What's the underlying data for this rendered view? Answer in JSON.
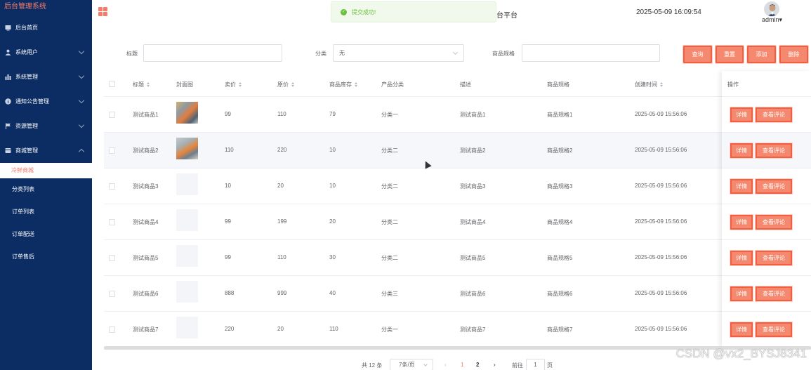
{
  "sidebar": {
    "brand": "后台管理系统",
    "items": [
      {
        "label": "后台首页",
        "icon": "home-icon"
      },
      {
        "label": "系统用户",
        "icon": "user-icon",
        "expandable": true
      },
      {
        "label": "系统管理",
        "icon": "bar-chart-icon",
        "expandable": true
      },
      {
        "label": "通知公告管理",
        "icon": "info-icon",
        "expandable": true
      },
      {
        "label": "资源管理",
        "icon": "flag-icon",
        "expandable": true
      },
      {
        "label": "商城管理",
        "icon": "shop-icon",
        "expandable": true,
        "expanded": true
      }
    ],
    "submenu": {
      "active": "冷鲜商城",
      "items": [
        "分类列表",
        "订单列表",
        "订单配送",
        "订单售后"
      ]
    }
  },
  "header": {
    "site_title_visible": "台平台",
    "datetime": "2025-05-09 16:09:54",
    "user": "admin▾",
    "toast": "提交成功!"
  },
  "search": {
    "title_label": "标题",
    "title_value": "",
    "category_label": "分类",
    "category_value": "无",
    "spec_label": "商品规格",
    "spec_value": "",
    "buttons": {
      "query": "查询",
      "reset": "重置",
      "add": "添加",
      "delete": "删除"
    }
  },
  "table": {
    "headers": {
      "title": "标题",
      "cover": "封面图",
      "price": "卖价",
      "original_price": "原价",
      "stock": "商品库存",
      "category": "产品分类",
      "description": "描述",
      "spec": "商品规格",
      "created": "创建时间",
      "ops": "操作"
    },
    "rows": [
      {
        "title": "测试商品1",
        "cover": "image",
        "price": "99",
        "original_price": "110",
        "stock": "79",
        "category": "分类一",
        "description": "测试商品1",
        "spec": "商品规格1",
        "created": "2025-05-09 15:56:06",
        "detail": "详情",
        "comments": "查看评论"
      },
      {
        "title": "测试商品2",
        "cover": "image",
        "price": "110",
        "original_price": "220",
        "stock": "10",
        "category": "分类二",
        "description": "测试商品2",
        "spec": "商品规格2",
        "created": "2025-05-09 15:56:06",
        "detail": "详情",
        "comments": "查看评论"
      },
      {
        "title": "测试商品3",
        "cover": "",
        "price": "10",
        "original_price": "20",
        "stock": "10",
        "category": "分类二",
        "description": "测试商品3",
        "spec": "商品规格3",
        "created": "2025-05-09 15:56:06",
        "detail": "详情",
        "comments": "查看评论"
      },
      {
        "title": "测试商品4",
        "cover": "",
        "price": "99",
        "original_price": "199",
        "stock": "20",
        "category": "分类二",
        "description": "测试商品4",
        "spec": "商品规格4",
        "created": "2025-05-09 15:56:06",
        "detail": "详情",
        "comments": "查看评论"
      },
      {
        "title": "测试商品5",
        "cover": "",
        "price": "99",
        "original_price": "110",
        "stock": "30",
        "category": "分类二",
        "description": "测试商品5",
        "spec": "商品规格5",
        "created": "2025-05-09 15:56:06",
        "detail": "详情",
        "comments": "查看评论"
      },
      {
        "title": "测试商品6",
        "cover": "",
        "price": "888",
        "original_price": "999",
        "stock": "40",
        "category": "分类三",
        "description": "测试商品6",
        "spec": "商品规格6",
        "created": "2025-05-09 15:56:06",
        "detail": "详情",
        "comments": "查看评论"
      },
      {
        "title": "测试商品7",
        "cover": "",
        "price": "220",
        "original_price": "20",
        "stock": "110",
        "category": "分类一",
        "description": "测试商品7",
        "spec": "商品规格7",
        "created": "2025-05-09 15:56:06",
        "detail": "详情",
        "comments": "查看评论"
      }
    ]
  },
  "pagination": {
    "total": "共 12 条",
    "page_size": "7条/页",
    "prev": "‹",
    "pages": [
      "1",
      "2"
    ],
    "current": "1",
    "next": "›",
    "goto_label": "前往",
    "goto_value": "1",
    "goto_suffix": "页"
  },
  "watermark": "CSDN @vx2_BYSJ8341",
  "colors": {
    "sidebar_bg": "#0c2d63",
    "accent": "#f47c6b",
    "button_bg": "#f5896f",
    "button_border": "#f25e41",
    "success": "#67c23a"
  }
}
